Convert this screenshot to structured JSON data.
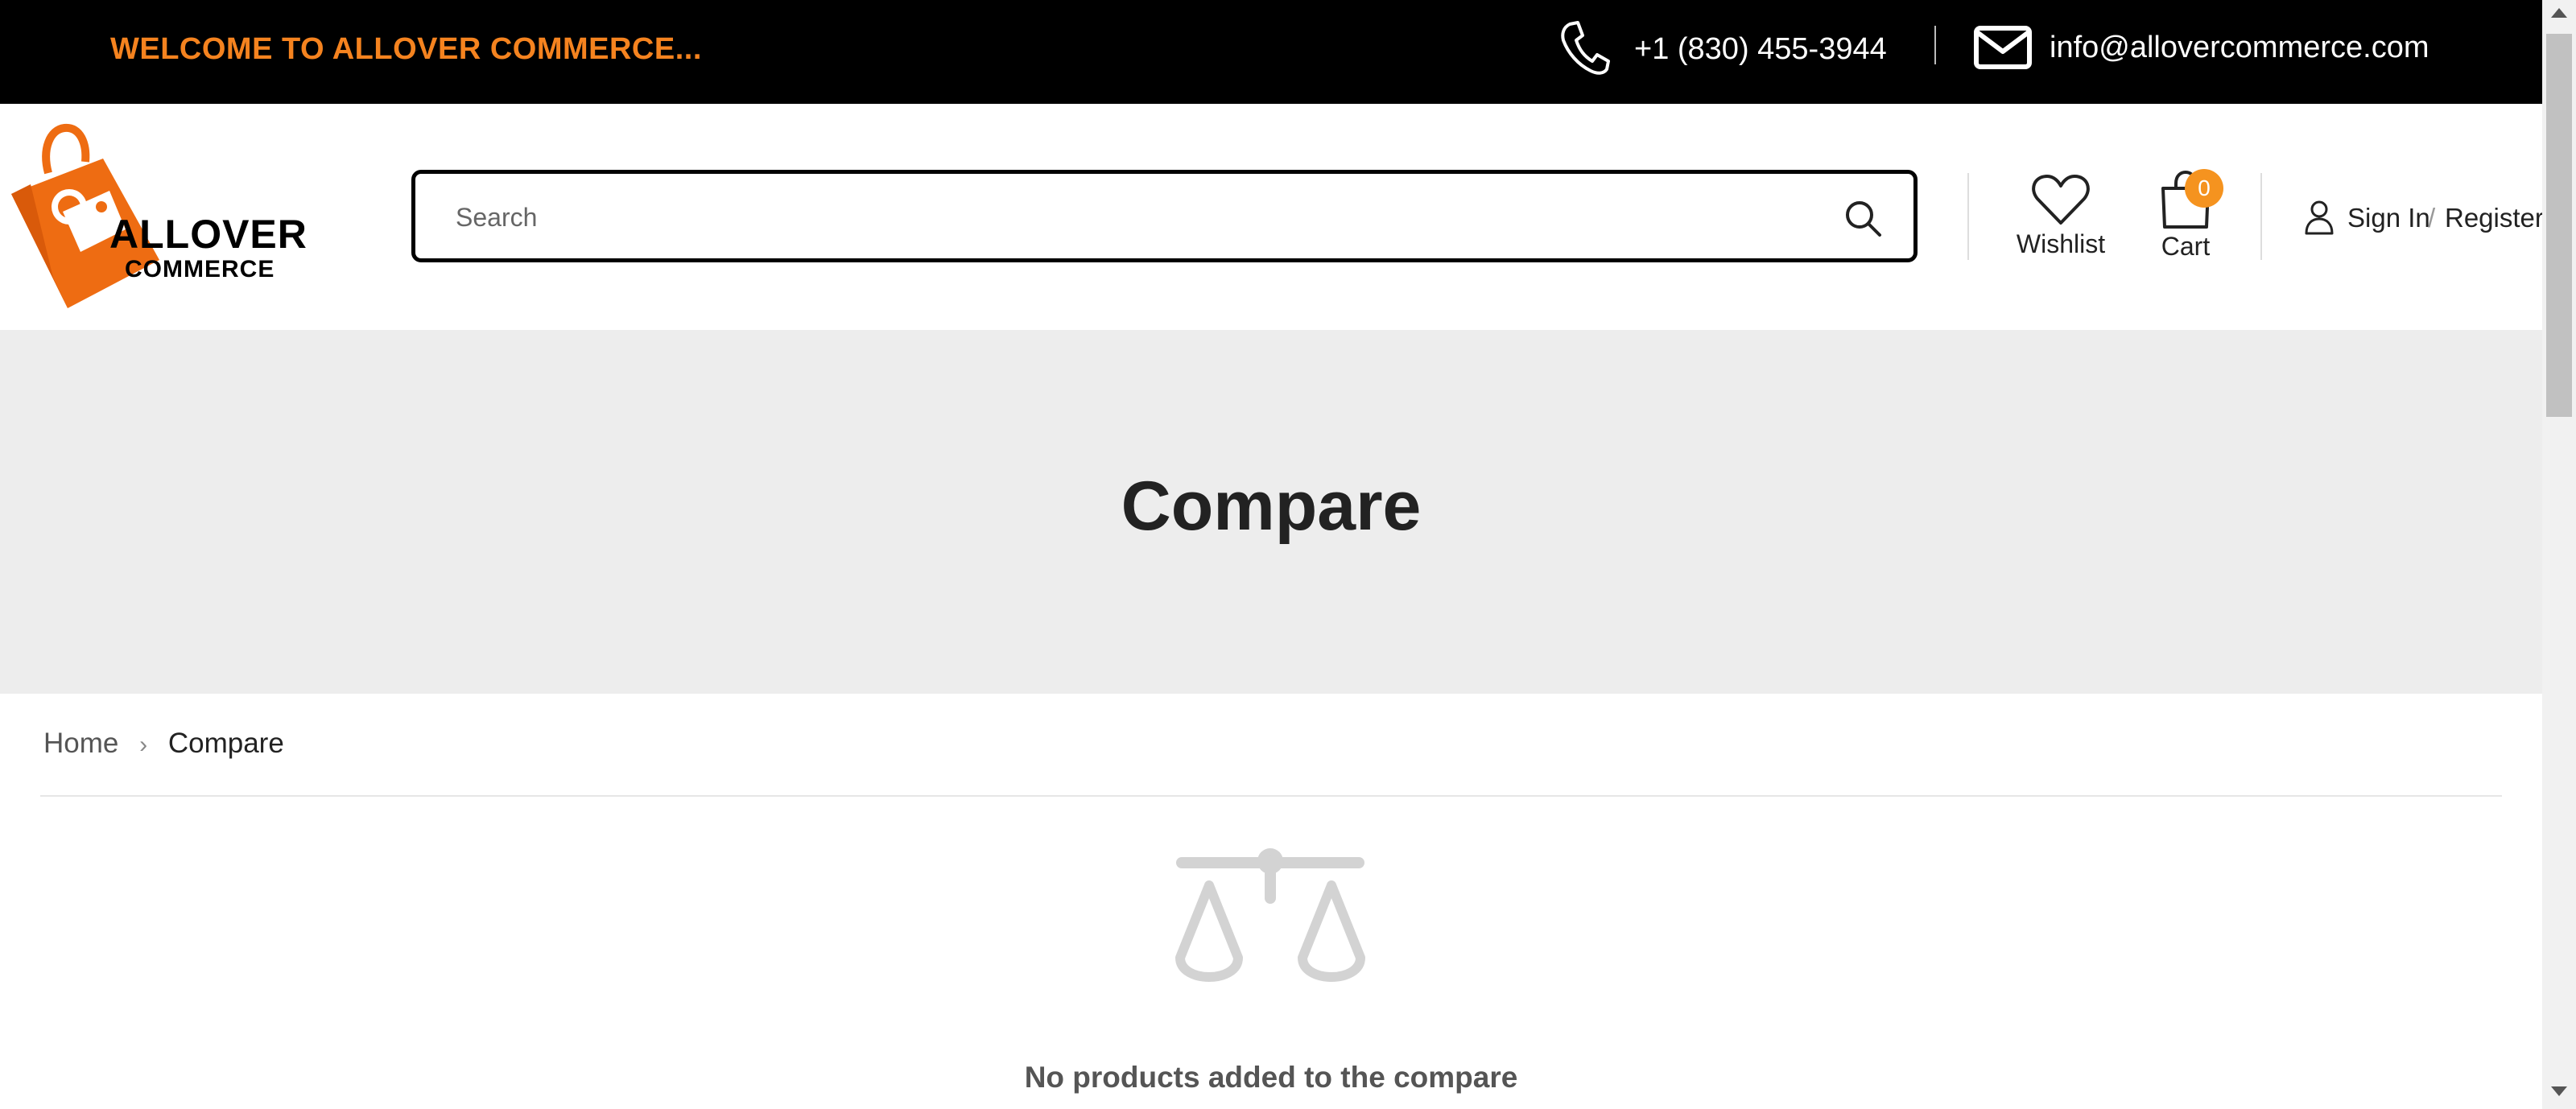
{
  "topbar": {
    "welcome": "WELCOME TO ALLOVER COMMERCE...",
    "phone": "+1 (830) 455-3944",
    "email": "info@allovercommerce.com"
  },
  "logo": {
    "line1": "ALLOVER",
    "line2": "COMMERCE"
  },
  "search": {
    "placeholder": "Search",
    "value": ""
  },
  "header": {
    "wishlist_label": "Wishlist",
    "cart_label": "Cart",
    "cart_count": "0",
    "signin_label": "Sign In",
    "separator": "/",
    "register_label": "Register"
  },
  "banner": {
    "title": "Compare"
  },
  "breadcrumb": {
    "items": [
      "Home",
      "Compare"
    ]
  },
  "empty_state": {
    "icon": "scale-icon",
    "message": "No products added to the compare"
  },
  "colors": {
    "accent": "#f5831f",
    "topbar_bg": "#000000",
    "banner_bg": "#ededed",
    "badge": "#f5931f"
  }
}
